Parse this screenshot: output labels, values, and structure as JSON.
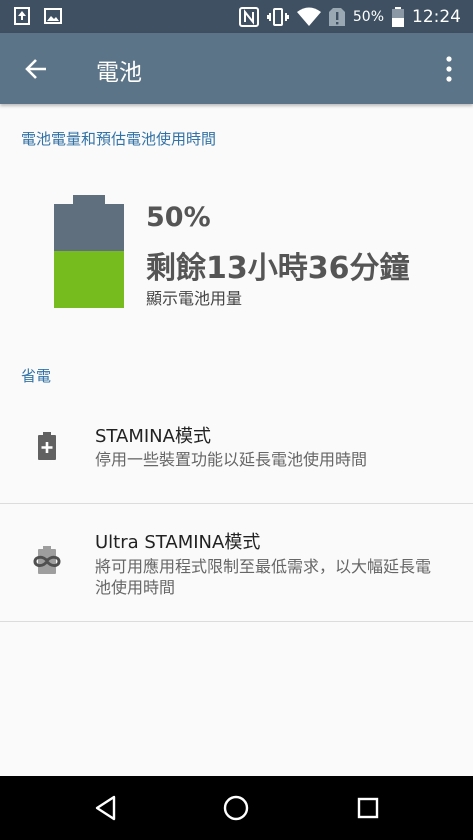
{
  "status_bar": {
    "battery_percent": "50%",
    "time": "12:24",
    "icons": [
      "upload-icon",
      "image-icon",
      "nfc-icon",
      "vibrate-icon",
      "wifi-icon",
      "alert-icon",
      "battery-icon"
    ]
  },
  "app_bar": {
    "title": "電池",
    "back_icon": "arrow-left-icon",
    "more_icon": "more-vert-icon"
  },
  "battery_section": {
    "header": "電池電量和預估電池使用時間",
    "percent": "50%",
    "level": 0.5,
    "remaining": "剩餘13小時36分鐘",
    "subtext": "顯示電池用量"
  },
  "power_saving": {
    "header": "省電",
    "items": [
      {
        "title": "STAMINA模式",
        "subtitle": "停用一些裝置功能以延長電池使用時間",
        "icon": "battery-plus-icon"
      },
      {
        "title": "Ultra STAMINA模式",
        "subtitle": "將可用應用程式限制至最低需求，以大幅延長電池使用時間",
        "icon": "battery-infinity-icon"
      }
    ]
  },
  "colors": {
    "status_bar": "#3e5061",
    "app_bar": "#5c7487",
    "section_header": "#3372a6",
    "battery_fill": "#77bc1f",
    "battery_empty": "#5f6f7d"
  },
  "nav_bar": {
    "icons": [
      "back-triangle-icon",
      "home-icon",
      "recents-icon"
    ]
  }
}
